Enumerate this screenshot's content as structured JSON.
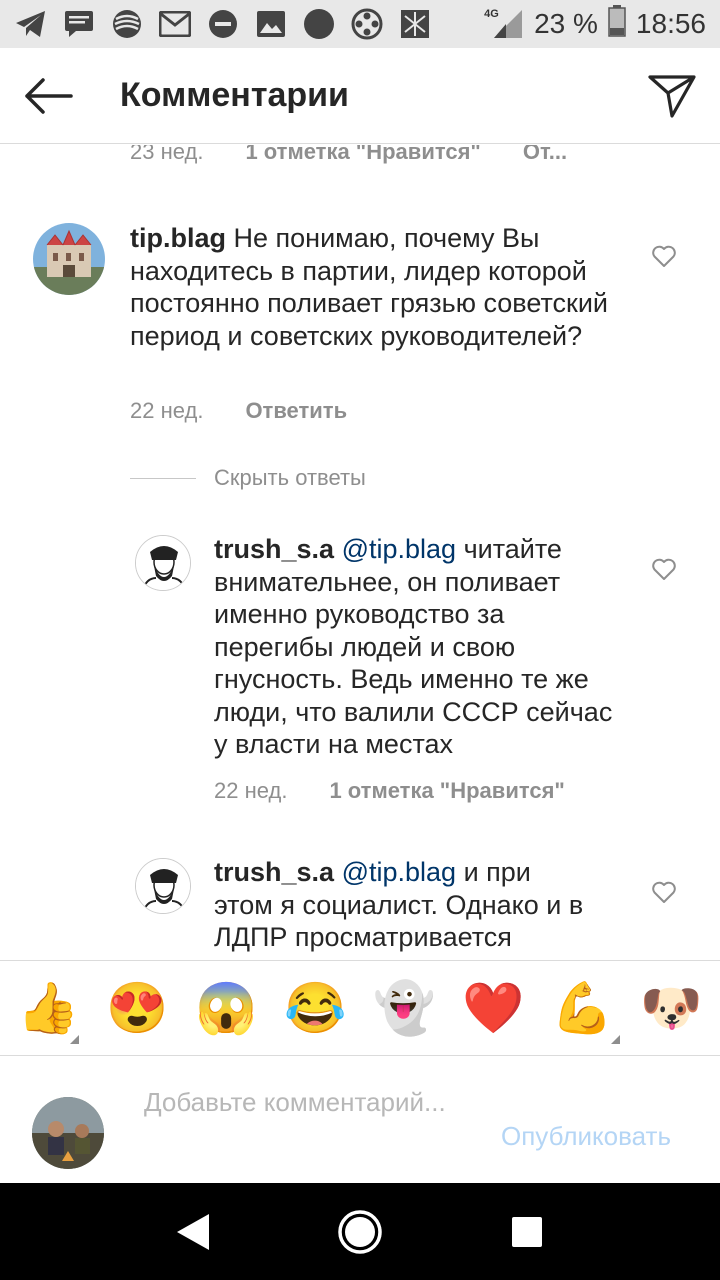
{
  "statusbar": {
    "signal": "4G",
    "battery": "23 %",
    "time": "18:56"
  },
  "appbar": {
    "title": "Комментарии"
  },
  "top_meta": {
    "time": "23 нед.",
    "likes": "1 отметка \"Нравится\"",
    "reply": "От..."
  },
  "comment1": {
    "user": "tip.blag",
    "text": " Не понимаю, почему Вы находитесь в партии, лидер которой постоянно поливает грязью советский период и советских руководителей?",
    "time": "22 нед.",
    "reply": "Ответить"
  },
  "hide_replies": "Скрыть ответы",
  "reply1": {
    "user": "trush_s.a",
    "mention": "@tip.blag",
    "text": " читайте внимательнее, он поливает именно руководство за перегибы людей и свою гнусность. Ведь именно те же люди, что валили СССР сейчас у власти на местах",
    "time": "22 нед.",
    "likes": "1 отметка \"Нравится\""
  },
  "reply2": {
    "user": "trush_s.a",
    "mention": "@tip.blag",
    "text": " и при этом я социалист. Однако и в ЛДПР просматривается"
  },
  "emojis": [
    "👍",
    "😍",
    "😱",
    "😂",
    "👻",
    "❤️",
    "💪",
    "🐶"
  ],
  "input": {
    "placeholder": "Добавьте комментарий...",
    "publish": "Опубликовать"
  },
  "colors": {
    "mention": "#003569",
    "publish_disabled": "#b4d5f5",
    "meta": "#8e8e8e"
  }
}
